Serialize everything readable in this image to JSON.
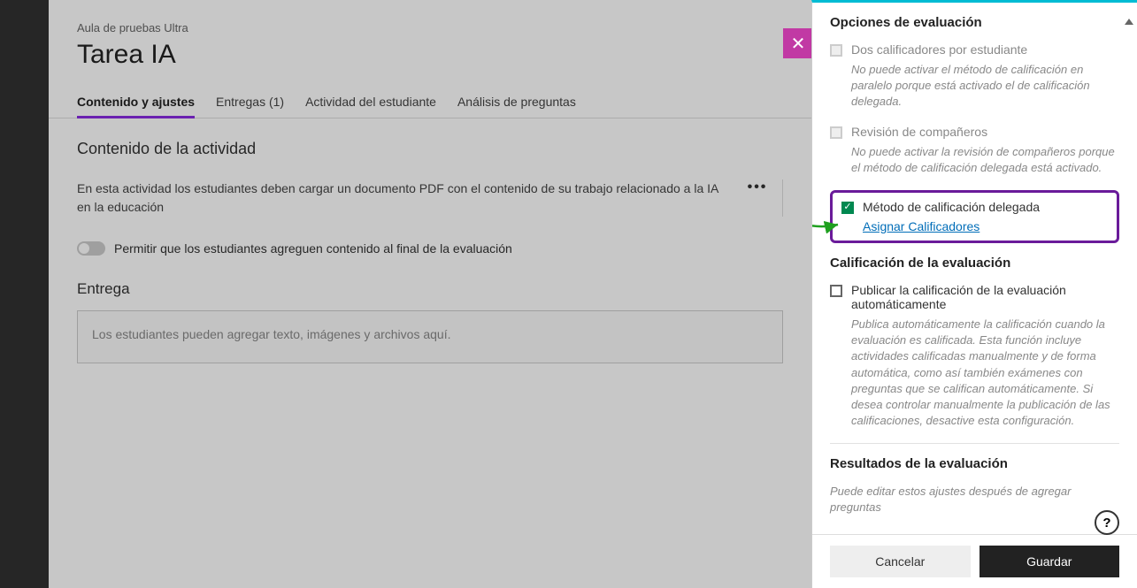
{
  "header": {
    "breadcrumb": "Aula de pruebas Ultra",
    "title": "Tarea IA"
  },
  "tabs": [
    {
      "label": "Contenido y ajustes",
      "active": true
    },
    {
      "label": "Entregas (1)",
      "active": false
    },
    {
      "label": "Actividad del estudiante",
      "active": false
    },
    {
      "label": "Análisis de preguntas",
      "active": false
    }
  ],
  "content": {
    "section_title": "Contenido de la actividad",
    "description": "En esta actividad los estudiantes deben cargar un documento PDF con el contenido de su trabajo relacionado a la IA en la educación",
    "toggle_label": "Permitir que los estudiantes agreguen contenido al final de la evaluación",
    "submission_title": "Entrega",
    "dropzone_text": "Los estudiantes pueden agregar texto, imágenes y archivos aquí."
  },
  "side": {
    "eval_options_title": "Opciones de evaluación",
    "two_graders": {
      "label": "Dos calificadores por estudiante",
      "hint": "No puede activar el método de calificación en paralelo porque está activado el de calificación delegada."
    },
    "peer_review": {
      "label": "Revisión de compañeros",
      "hint": "No puede activar la revisión de compañeros porque el método de calificación delegada está activado."
    },
    "delegated": {
      "label": "Método de calificación delegada",
      "link": "Asignar Calificadores"
    },
    "grade_title": "Calificación de la evaluación",
    "auto_post": {
      "label": "Publicar la calificación de la evaluación automáticamente",
      "hint": "Publica automáticamente la calificación cuando la evaluación es calificada. Esta función incluye actividades calificadas manualmente y de forma automática, como así también exámenes con preguntas que se califican automáticamente. Si desea controlar manualmente la publicación de las calificaciones, desactive esta configuración."
    },
    "results_title": "Resultados de la evaluación",
    "results_hint": "Puede editar estos ajustes después de agregar preguntas"
  },
  "footer": {
    "cancel": "Cancelar",
    "save": "Guardar"
  },
  "icons": {
    "help": "?"
  }
}
